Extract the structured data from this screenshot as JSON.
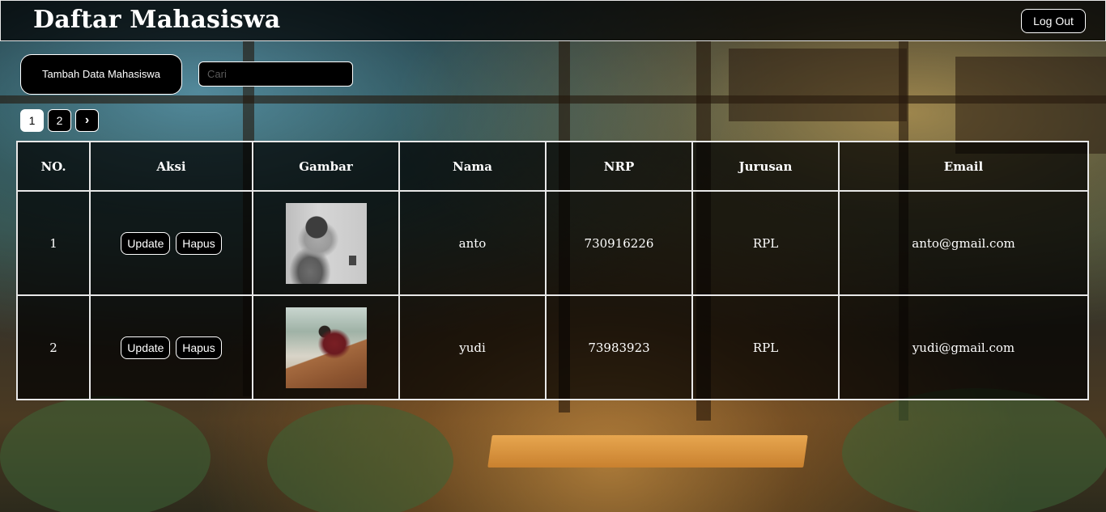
{
  "header": {
    "title": "Daftar Mahasiswa",
    "logout_label": "Log Out"
  },
  "toolbar": {
    "add_label": "Tambah Data Mahasiswa",
    "search_placeholder": "Cari",
    "search_value": ""
  },
  "pagination": {
    "pages": [
      "1",
      "2"
    ],
    "current": "1",
    "next_icon": "chevron-right-icon",
    "next_glyph": "›"
  },
  "table": {
    "headers": [
      "NO.",
      "Aksi",
      "Gambar",
      "Nama",
      "NRP",
      "Jurusan",
      "Email"
    ],
    "rows": [
      {
        "no": "1",
        "update_label": "Update",
        "delete_label": "Hapus",
        "photo": "student-photo-anto",
        "nama": "anto",
        "nrp": "730916226",
        "jurusan": "RPL",
        "email": "anto@gmail.com"
      },
      {
        "no": "2",
        "update_label": "Update",
        "delete_label": "Hapus",
        "photo": "student-photo-yudi",
        "nama": "yudi",
        "nrp": "73983923",
        "jurusan": "RPL",
        "email": "yudi@gmail.com"
      }
    ]
  },
  "colors": {
    "panel_background": "#000000",
    "border": "#ffffff",
    "text": "#ffffff"
  }
}
